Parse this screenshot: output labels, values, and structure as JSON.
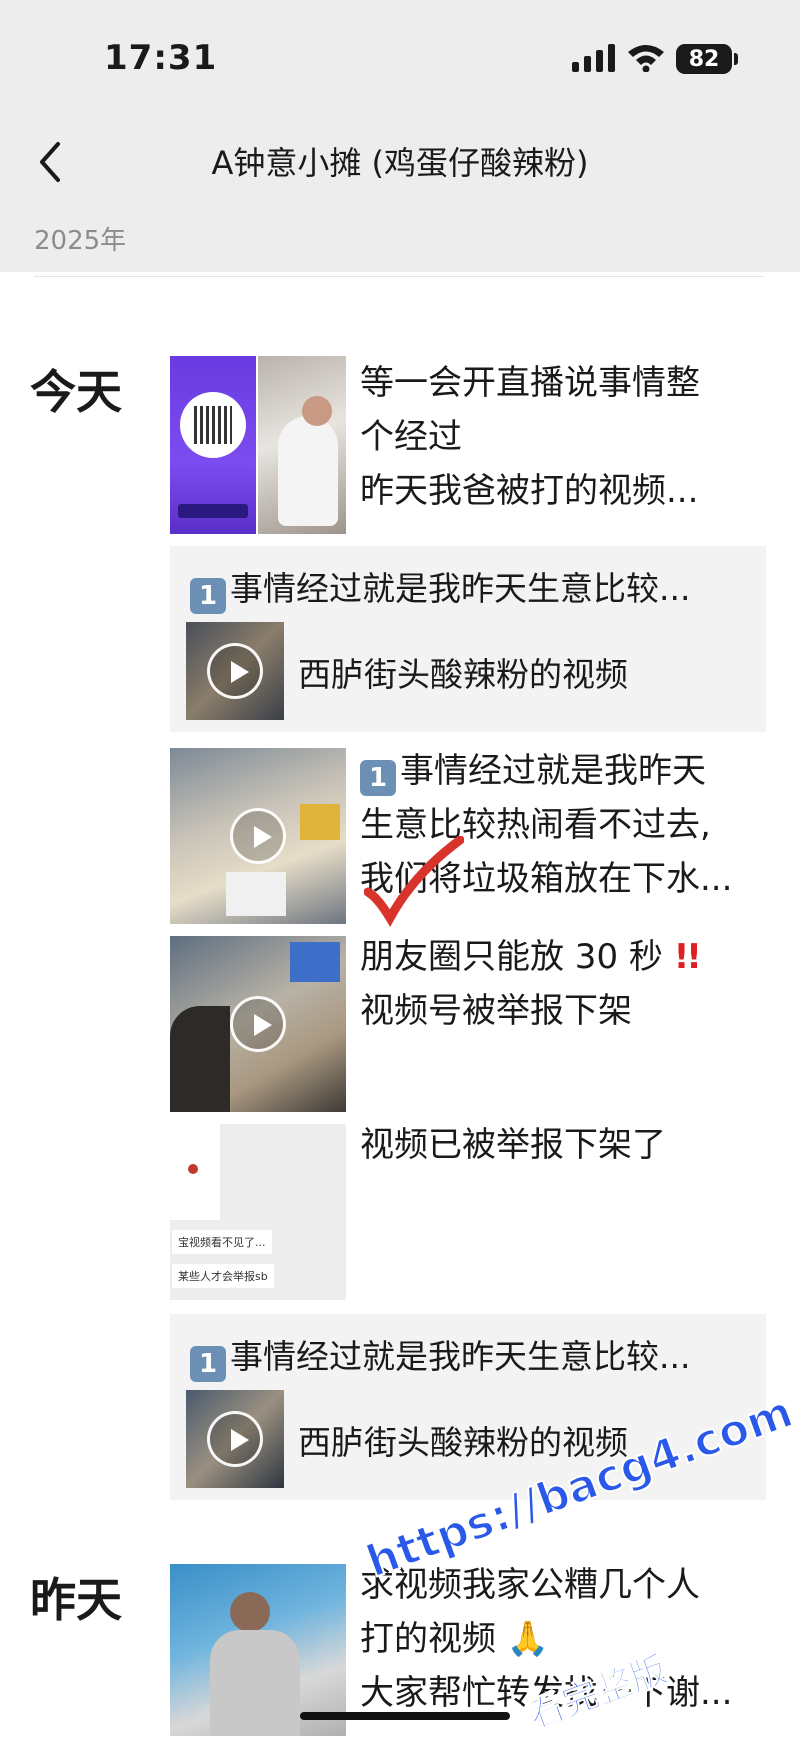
{
  "status_bar": {
    "time": "17:31",
    "battery": "82"
  },
  "nav": {
    "title": "A钟意小摊 (鸡蛋仔酸辣粉)"
  },
  "year_label": "2025年",
  "days": {
    "today": "今天",
    "yesterday": "昨天"
  },
  "posts": {
    "p1": {
      "lines": [
        "等一会开直播说事情整",
        "个经过",
        "昨天我爸被打的视频..."
      ]
    },
    "share1": {
      "badge": "1",
      "title": "事情经过就是我昨天生意比较...",
      "caption": "西胪街头酸辣粉的视频"
    },
    "p2": {
      "badge": "1",
      "lines": [
        "事情经过就是我昨天",
        "生意比较热闹看不过去,",
        "我们将垃圾箱放在下水..."
      ]
    },
    "p3": {
      "line1": "朋友圈只能放 30 秒",
      "exclaim": "!!",
      "line2": "视频号被举报下架"
    },
    "p4": {
      "line1": "视频已被举报下架了",
      "shot_text1": "宝视频看不见了...",
      "shot_text2": "某些人才会举报sb"
    },
    "share2": {
      "badge": "1",
      "title": "事情经过就是我昨天生意比较...",
      "caption": "西胪街头酸辣粉的视频"
    },
    "p5": {
      "line1": "求视频我家公糟几个人",
      "line2": "打的视频",
      "line3": "大家帮忙转发找一下谢..."
    }
  },
  "watermark": {
    "line1": "https://bacg4.com",
    "line2": "看完整版"
  },
  "colors": {
    "bar_bg": "#ededed",
    "card_bg": "#f3f3f3",
    "badge": "#6b8fb5",
    "accent_red": "#e02020",
    "watermark": "#2a58e8"
  }
}
